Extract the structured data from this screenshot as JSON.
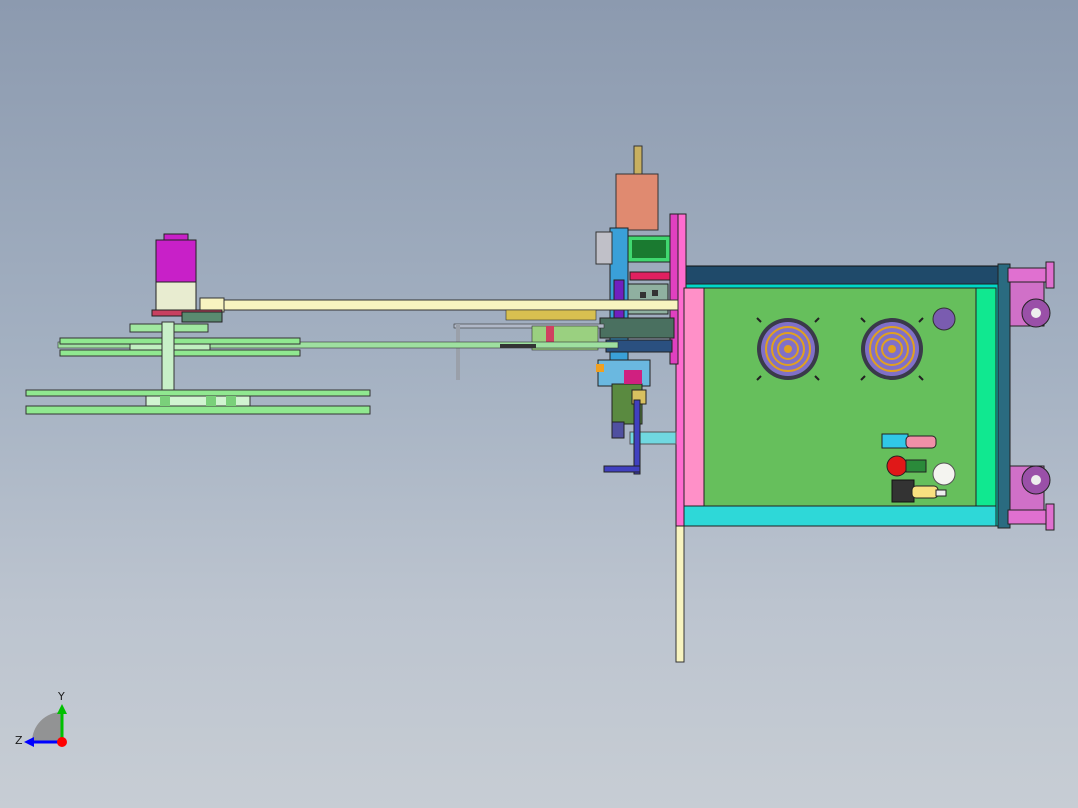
{
  "viewport": {
    "background_top": "#8c9aaf",
    "background_bottom": "#c7cdd4"
  },
  "triad": {
    "y_label": "Y",
    "z_label": "Z",
    "x_color": "#ff0000",
    "y_color": "#00c000",
    "z_color": "#0000ff"
  },
  "model": {
    "frame_color": "#00e0c0",
    "panel_color": "#6cc05a",
    "side_plate_color": "#ff78c8",
    "motor_color": "#c820c8",
    "arm_color": "#f8f4c0",
    "top_bar_color": "#1f4a6a",
    "caster_color": "#e070d0",
    "fan_icons": [
      "fan-grille-icon",
      "fan-grille-icon"
    ]
  }
}
